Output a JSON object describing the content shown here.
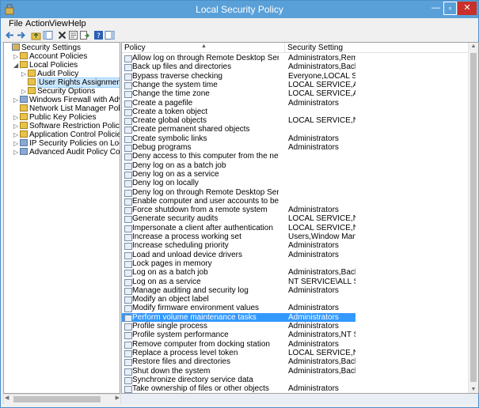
{
  "window": {
    "title": "Local Security Policy",
    "icons": {
      "app": "security-settings-icon",
      "minimize": "minimize-icon",
      "maximize": "maximize-icon",
      "close": "close-icon"
    }
  },
  "menu": [
    "File",
    "Action",
    "View",
    "Help"
  ],
  "toolbar": [
    "back-arrow-icon",
    "forward-arrow-icon",
    "up-folder-icon",
    "show-hide-tree-icon",
    "delete-icon",
    "properties-icon",
    "export-list-icon",
    "help-icon",
    "show-hide-action-pane-icon"
  ],
  "tree": [
    {
      "label": "Security Settings",
      "level": 0,
      "exp": "",
      "icon": "security-settings-icon"
    },
    {
      "label": "Account Policies",
      "level": 1,
      "exp": "▷",
      "icon": "folder-icon"
    },
    {
      "label": "Local Policies",
      "level": 1,
      "exp": "◢",
      "icon": "folder-icon"
    },
    {
      "label": "Audit Policy",
      "level": 2,
      "exp": "▷",
      "icon": "folder-icon"
    },
    {
      "label": "User Rights Assignment",
      "level": 2,
      "exp": "",
      "icon": "folder-open-icon",
      "selected": true
    },
    {
      "label": "Security Options",
      "level": 2,
      "exp": "▷",
      "icon": "folder-icon"
    },
    {
      "label": "Windows Firewall with Advanced Security",
      "level": 1,
      "exp": "▷",
      "icon": "firewall-icon"
    },
    {
      "label": "Network List Manager Policies",
      "level": 1,
      "exp": "",
      "icon": "folder-icon"
    },
    {
      "label": "Public Key Policies",
      "level": 1,
      "exp": "▷",
      "icon": "folder-icon"
    },
    {
      "label": "Software Restriction Policies",
      "level": 1,
      "exp": "▷",
      "icon": "folder-icon"
    },
    {
      "label": "Application Control Policies",
      "level": 1,
      "exp": "▷",
      "icon": "folder-icon"
    },
    {
      "label": "IP Security Policies on Local Computer",
      "level": 1,
      "exp": "▷",
      "icon": "ip-security-icon"
    },
    {
      "label": "Advanced Audit Policy Configuration",
      "level": 1,
      "exp": "▷",
      "icon": "audit-icon"
    }
  ],
  "columns": {
    "policy": "Policy",
    "setting": "Security Setting"
  },
  "policies": [
    {
      "policy": "Allow log on through Remote Desktop Services",
      "setting": "Administrators,Remote ..."
    },
    {
      "policy": "Back up files and directories",
      "setting": "Administrators,Backup ..."
    },
    {
      "policy": "Bypass traverse checking",
      "setting": "Everyone,LOCAL SERVIC..."
    },
    {
      "policy": "Change the system time",
      "setting": "LOCAL SERVICE,Admini..."
    },
    {
      "policy": "Change the time zone",
      "setting": "LOCAL SERVICE,Admini..."
    },
    {
      "policy": "Create a pagefile",
      "setting": "Administrators"
    },
    {
      "policy": "Create a token object",
      "setting": ""
    },
    {
      "policy": "Create global objects",
      "setting": "LOCAL SERVICE,NETWO..."
    },
    {
      "policy": "Create permanent shared objects",
      "setting": ""
    },
    {
      "policy": "Create symbolic links",
      "setting": "Administrators"
    },
    {
      "policy": "Debug programs",
      "setting": "Administrators"
    },
    {
      "policy": "Deny access to this computer from the network",
      "setting": ""
    },
    {
      "policy": "Deny log on as a batch job",
      "setting": ""
    },
    {
      "policy": "Deny log on as a service",
      "setting": ""
    },
    {
      "policy": "Deny log on locally",
      "setting": ""
    },
    {
      "policy": "Deny log on through Remote Desktop Services",
      "setting": ""
    },
    {
      "policy": "Enable computer and user accounts to be trusted for delega...",
      "setting": ""
    },
    {
      "policy": "Force shutdown from a remote system",
      "setting": "Administrators"
    },
    {
      "policy": "Generate security audits",
      "setting": "LOCAL SERVICE,NETWO..."
    },
    {
      "policy": "Impersonate a client after authentication",
      "setting": "LOCAL SERVICE,NETWO..."
    },
    {
      "policy": "Increase a process working set",
      "setting": "Users,Window Manager..."
    },
    {
      "policy": "Increase scheduling priority",
      "setting": "Administrators"
    },
    {
      "policy": "Load and unload device drivers",
      "setting": "Administrators"
    },
    {
      "policy": "Lock pages in memory",
      "setting": ""
    },
    {
      "policy": "Log on as a batch job",
      "setting": "Administrators,Backup ..."
    },
    {
      "policy": "Log on as a service",
      "setting": "NT SERVICE\\ALL SERVIC..."
    },
    {
      "policy": "Manage auditing and security log",
      "setting": "Administrators"
    },
    {
      "policy": "Modify an object label",
      "setting": ""
    },
    {
      "policy": "Modify firmware environment values",
      "setting": "Administrators"
    },
    {
      "policy": "Perform volume maintenance tasks",
      "setting": "Administrators",
      "selected": true
    },
    {
      "policy": "Profile single process",
      "setting": "Administrators"
    },
    {
      "policy": "Profile system performance",
      "setting": "Administrators,NT SERVI..."
    },
    {
      "policy": "Remove computer from docking station",
      "setting": "Administrators"
    },
    {
      "policy": "Replace a process level token",
      "setting": "LOCAL SERVICE,NETWO..."
    },
    {
      "policy": "Restore files and directories",
      "setting": "Administrators,Backup ..."
    },
    {
      "policy": "Shut down the system",
      "setting": "Administrators,Backup ..."
    },
    {
      "policy": "Synchronize directory service data",
      "setting": ""
    },
    {
      "policy": "Take ownership of files or other objects",
      "setting": "Administrators"
    }
  ],
  "colors": {
    "titlebar": "#5aa0d8",
    "selection": "#3399ff",
    "tree_selection": "#cce8ff",
    "close": "#c7302b"
  }
}
